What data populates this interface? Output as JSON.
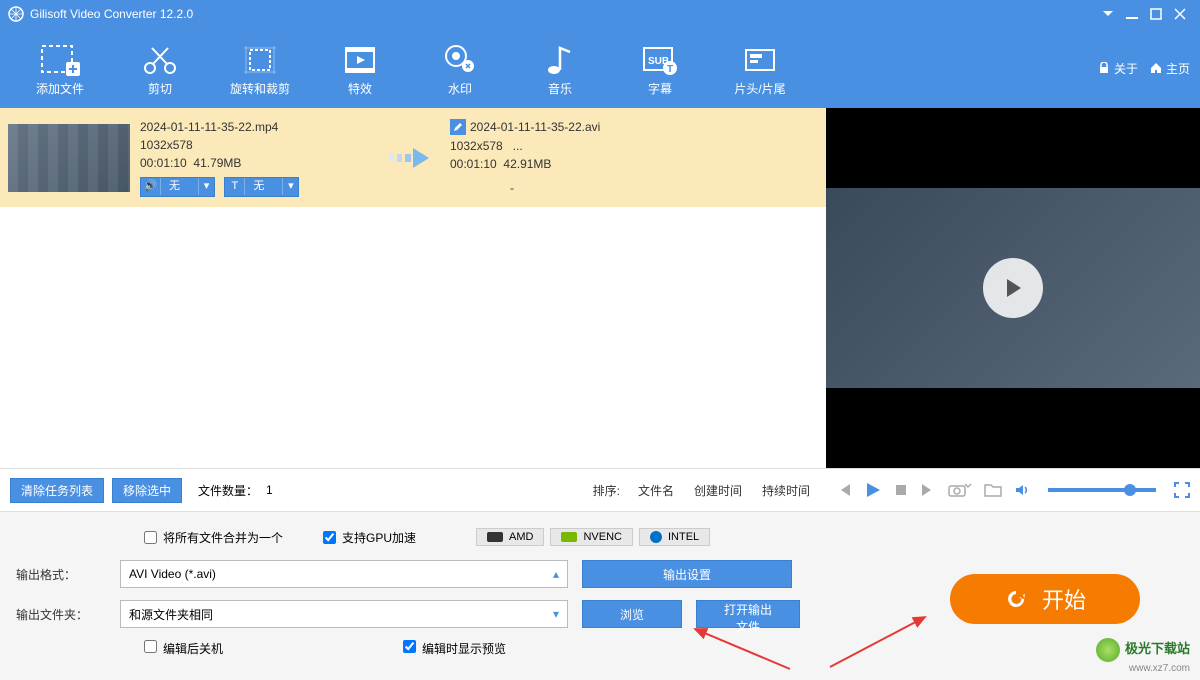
{
  "title": "Gilisoft Video Converter 12.2.0",
  "header_links": {
    "about": "关于",
    "home": "主页"
  },
  "toolbar": [
    {
      "id": "add-file",
      "label": "添加文件"
    },
    {
      "id": "cut",
      "label": "剪切"
    },
    {
      "id": "rotate-crop",
      "label": "旋转和裁剪"
    },
    {
      "id": "effects",
      "label": "特效"
    },
    {
      "id": "watermark",
      "label": "水印"
    },
    {
      "id": "music",
      "label": "音乐"
    },
    {
      "id": "subtitle",
      "label": "字幕"
    },
    {
      "id": "head-tail",
      "label": "片头/片尾"
    }
  ],
  "task": {
    "source": {
      "name": "2024-01-11-11-35-22.mp4",
      "resolution": "1032x578",
      "duration": "00:01:10",
      "size": "41.79MB",
      "audio_pill": "无",
      "text_pill": "无"
    },
    "target": {
      "name": "2024-01-11-11-35-22.avi",
      "resolution": "1032x578",
      "resolution_extra": "...",
      "duration": "00:01:10",
      "size": "42.91MB",
      "dash": "-"
    }
  },
  "listbar": {
    "clear": "清除任务列表",
    "remove": "移除选中",
    "count_label": "文件数量：",
    "count_value": "1",
    "sort_label": "排序:",
    "sort_opts": [
      "文件名",
      "创建时间",
      "持续时间"
    ]
  },
  "bottom": {
    "merge_label": "将所有文件合并为一个",
    "gpu_label": "支持GPU加速",
    "chips": [
      "AMD",
      "NVENC",
      "INTEL"
    ],
    "format_label": "输出格式：",
    "format_value": "AVI Video (*.avi)",
    "settings_btn": "输出设置",
    "folder_label": "输出文件夹：",
    "folder_value": "和源文件夹相同",
    "browse_btn": "浏览",
    "open_btn": "打开输出文件",
    "shutdown_label": "编辑后关机",
    "preview_label": "编辑时显示预览",
    "start_btn": "开始"
  },
  "watermark": {
    "line1": "极光下载站",
    "line2": "www.xz7.com"
  }
}
